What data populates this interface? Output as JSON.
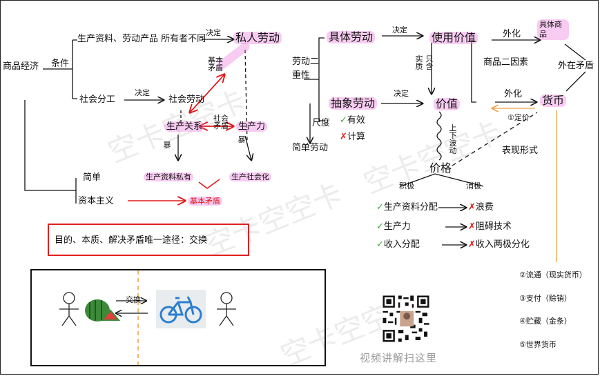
{
  "colors": {
    "red": "#e01818",
    "green": "#3aa83a",
    "highlight": "#ec78dc",
    "orange": "#f0a040"
  },
  "left": {
    "commodity_economy": "商品经济",
    "conditions": "条件",
    "ownership_diff": "生产资料、劳动产品 所有者不同",
    "decides1": "决定",
    "private_labor": "私人劳动",
    "basic_contradiction": "基本矛盾",
    "social_division": "社会分工",
    "decides2": "决定",
    "social_labor": "社会劳动",
    "relations": "生产关系",
    "social_contradiction": "社会矛盾",
    "productivity": "生产力",
    "violent": "暴",
    "violent2": "暴",
    "simple": "简单",
    "means_private": "生产资料私有",
    "capitalism": "资本主义",
    "socialization": "生产社会化",
    "basic_contradiction2": "基本矛盾"
  },
  "summary": "目的、本质、解决矛盾唯一途径：交换",
  "right": {
    "concrete_labor": "具体劳动",
    "decides3": "决定",
    "use_value": "使用价值",
    "externalize1": "外化",
    "concrete_goods": "具体商品",
    "dual_nature": "劳动二重性",
    "essence": "实质",
    "only": "只含",
    "two_factors": "商品二因素",
    "external_contradiction": "外在矛盾",
    "abstract_labor": "抽象劳动",
    "decides4": "决定",
    "value": "价值",
    "externalize2": "外化",
    "money": "货币",
    "measure": "尺度",
    "yes_effective": "有效",
    "no_calc": "计算",
    "fixed_price": "①定价",
    "simple_labor": "简单劳动",
    "up_down": "上下波动",
    "price": "价格",
    "expression": "表现形式",
    "positive": "积极",
    "negative": "消极",
    "item1_good": "生产资料分配",
    "item1_bad": "浪费",
    "item2_good": "生产力",
    "item2_bad": "阻碍技术",
    "item3_good": "收入分配",
    "item3_bad": "收入两极分化",
    "functions": [
      "②流通（现实货币）",
      "③支付（赊销）",
      "④贮藏（金条）",
      "⑤世界货币"
    ]
  },
  "panel": {
    "exchange": "交换"
  },
  "qr_caption": "视频讲解扫这里",
  "watermark": "空卡空空卡"
}
